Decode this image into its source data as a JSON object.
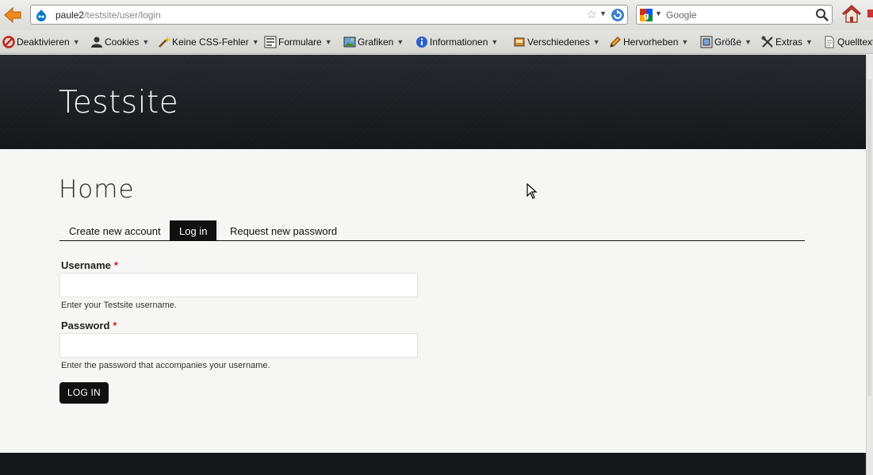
{
  "browser": {
    "url_host": "paule2",
    "url_path": "/testsite/user/login",
    "search_engine": "Google"
  },
  "toolbar": {
    "items": [
      {
        "label": "Deaktivieren",
        "icon": "forbidden-icon"
      },
      {
        "label": "Cookies",
        "icon": "user-icon"
      },
      {
        "label": "Keine CSS-Fehler",
        "icon": "wand-icon"
      },
      {
        "label": "Formulare",
        "icon": "form-icon"
      },
      {
        "label": "Grafiken",
        "icon": "image-icon"
      },
      {
        "label": "Informationen",
        "icon": "info-icon"
      },
      {
        "label": "Verschiedenes",
        "icon": "misc-icon"
      },
      {
        "label": "Hervorheben",
        "icon": "pencil-icon"
      },
      {
        "label": "Größe",
        "icon": "resize-icon"
      },
      {
        "label": "Extras",
        "icon": "tools-icon"
      },
      {
        "label": "Quelltext",
        "icon": "source-icon"
      }
    ]
  },
  "site": {
    "name": "Testsite"
  },
  "page": {
    "title": "Home",
    "tabs": [
      {
        "label": "Create new account",
        "active": false
      },
      {
        "label": "Log in",
        "active": true
      },
      {
        "label": "Request new password",
        "active": false
      }
    ]
  },
  "form": {
    "username_label": "Username",
    "username_value": "",
    "username_help": "Enter your Testsite username.",
    "password_label": "Password",
    "password_value": "",
    "password_help": "Enter the password that accompanies your username.",
    "required_mark": "*",
    "submit_label": "LOG IN"
  },
  "colors": {
    "header_bg": "#1a1d21",
    "active_tab": "#111111",
    "required": "#cc2222"
  }
}
